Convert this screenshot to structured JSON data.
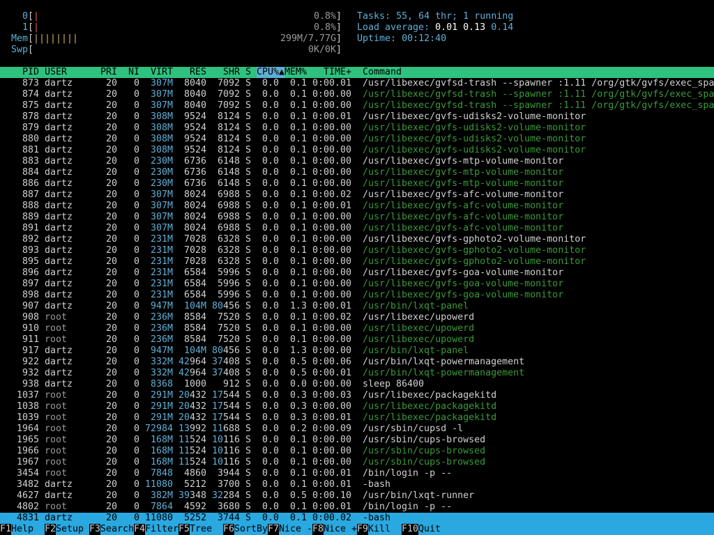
{
  "meters": {
    "cpu0": {
      "label": "0",
      "bar": "|",
      "value": "0.8%"
    },
    "cpu1": {
      "label": "1",
      "bar": "|",
      "value": "0.8%"
    },
    "mem": {
      "label": "Mem",
      "bar": "||||||||",
      "value": "299M/7.77G"
    },
    "swp": {
      "label": "Swp",
      "bar": "",
      "value": "0K/0K"
    }
  },
  "summary": {
    "tasks_label": "Tasks:",
    "tasks_count": "55",
    "threads": "64",
    "thr_label": "thr;",
    "running": "1",
    "running_label": "running",
    "load_label": "Load average:",
    "load1": "0.01",
    "load5": "0.13",
    "load15": "0.14",
    "uptime_label": "Uptime:",
    "uptime": "00:12:40"
  },
  "columns": {
    "pid": "PID",
    "user": "USER",
    "pri": "PRI",
    "ni": "NI",
    "virt": "VIRT",
    "res": "RES",
    "shr": "SHR",
    "s": "S",
    "cpu": "CPU%",
    "sort_arrow": "▲",
    "mem": "MEM%",
    "time": "TIME+",
    "command": "Command"
  },
  "processes": [
    {
      "pid": "873",
      "user": "dartz",
      "pri": "20",
      "ni": "0",
      "virt": "307M",
      "res": "8040",
      "shr": "7092",
      "s": "S",
      "cpu": "0.0",
      "mem": "0.1",
      "time": "0:00.01",
      "cmd": "/usr/libexec/gvfsd-trash --spawner :1.11 /org/gtk/gvfs/exec_spa",
      "thread": false
    },
    {
      "pid": "874",
      "user": "dartz",
      "pri": "20",
      "ni": "0",
      "virt": "307M",
      "res": "8040",
      "shr": "7092",
      "s": "S",
      "cpu": "0.0",
      "mem": "0.1",
      "time": "0:00.00",
      "cmd": "/usr/libexec/gvfsd-trash --spawner :1.11 /org/gtk/gvfs/exec_spa",
      "thread": true
    },
    {
      "pid": "875",
      "user": "dartz",
      "pri": "20",
      "ni": "0",
      "virt": "307M",
      "res": "8040",
      "shr": "7092",
      "s": "S",
      "cpu": "0.0",
      "mem": "0.1",
      "time": "0:00.00",
      "cmd": "/usr/libexec/gvfsd-trash --spawner :1.11 /org/gtk/gvfs/exec_spa",
      "thread": true
    },
    {
      "pid": "878",
      "user": "dartz",
      "pri": "20",
      "ni": "0",
      "virt": "308M",
      "res": "9524",
      "shr": "8124",
      "s": "S",
      "cpu": "0.0",
      "mem": "0.1",
      "time": "0:00.01",
      "cmd": "/usr/libexec/gvfs-udisks2-volume-monitor",
      "thread": false
    },
    {
      "pid": "879",
      "user": "dartz",
      "pri": "20",
      "ni": "0",
      "virt": "308M",
      "res": "9524",
      "shr": "8124",
      "s": "S",
      "cpu": "0.0",
      "mem": "0.1",
      "time": "0:00.00",
      "cmd": "/usr/libexec/gvfs-udisks2-volume-monitor",
      "thread": true
    },
    {
      "pid": "880",
      "user": "dartz",
      "pri": "20",
      "ni": "0",
      "virt": "308M",
      "res": "9524",
      "shr": "8124",
      "s": "S",
      "cpu": "0.0",
      "mem": "0.1",
      "time": "0:00.00",
      "cmd": "/usr/libexec/gvfs-udisks2-volume-monitor",
      "thread": true
    },
    {
      "pid": "881",
      "user": "dartz",
      "pri": "20",
      "ni": "0",
      "virt": "308M",
      "res": "9524",
      "shr": "8124",
      "s": "S",
      "cpu": "0.0",
      "mem": "0.1",
      "time": "0:00.00",
      "cmd": "/usr/libexec/gvfs-udisks2-volume-monitor",
      "thread": true
    },
    {
      "pid": "883",
      "user": "dartz",
      "pri": "20",
      "ni": "0",
      "virt": "230M",
      "res": "6736",
      "shr": "6148",
      "s": "S",
      "cpu": "0.0",
      "mem": "0.1",
      "time": "0:00.00",
      "cmd": "/usr/libexec/gvfs-mtp-volume-monitor",
      "thread": false
    },
    {
      "pid": "884",
      "user": "dartz",
      "pri": "20",
      "ni": "0",
      "virt": "230M",
      "res": "6736",
      "shr": "6148",
      "s": "S",
      "cpu": "0.0",
      "mem": "0.1",
      "time": "0:00.00",
      "cmd": "/usr/libexec/gvfs-mtp-volume-monitor",
      "thread": true
    },
    {
      "pid": "886",
      "user": "dartz",
      "pri": "20",
      "ni": "0",
      "virt": "230M",
      "res": "6736",
      "shr": "6148",
      "s": "S",
      "cpu": "0.0",
      "mem": "0.1",
      "time": "0:00.00",
      "cmd": "/usr/libexec/gvfs-mtp-volume-monitor",
      "thread": true
    },
    {
      "pid": "887",
      "user": "dartz",
      "pri": "20",
      "ni": "0",
      "virt": "307M",
      "res": "8024",
      "shr": "6988",
      "s": "S",
      "cpu": "0.0",
      "mem": "0.1",
      "time": "0:00.02",
      "cmd": "/usr/libexec/gvfs-afc-volume-monitor",
      "thread": false
    },
    {
      "pid": "888",
      "user": "dartz",
      "pri": "20",
      "ni": "0",
      "virt": "307M",
      "res": "8024",
      "shr": "6988",
      "s": "S",
      "cpu": "0.0",
      "mem": "0.1",
      "time": "0:00.01",
      "cmd": "/usr/libexec/gvfs-afc-volume-monitor",
      "thread": true
    },
    {
      "pid": "889",
      "user": "dartz",
      "pri": "20",
      "ni": "0",
      "virt": "307M",
      "res": "8024",
      "shr": "6988",
      "s": "S",
      "cpu": "0.0",
      "mem": "0.1",
      "time": "0:00.00",
      "cmd": "/usr/libexec/gvfs-afc-volume-monitor",
      "thread": true
    },
    {
      "pid": "891",
      "user": "dartz",
      "pri": "20",
      "ni": "0",
      "virt": "307M",
      "res": "8024",
      "shr": "6988",
      "s": "S",
      "cpu": "0.0",
      "mem": "0.1",
      "time": "0:00.00",
      "cmd": "/usr/libexec/gvfs-afc-volume-monitor",
      "thread": true
    },
    {
      "pid": "892",
      "user": "dartz",
      "pri": "20",
      "ni": "0",
      "virt": "231M",
      "res": "7028",
      "shr": "6328",
      "s": "S",
      "cpu": "0.0",
      "mem": "0.1",
      "time": "0:00.00",
      "cmd": "/usr/libexec/gvfs-gphoto2-volume-monitor",
      "thread": false
    },
    {
      "pid": "893",
      "user": "dartz",
      "pri": "20",
      "ni": "0",
      "virt": "231M",
      "res": "7028",
      "shr": "6328",
      "s": "S",
      "cpu": "0.0",
      "mem": "0.1",
      "time": "0:00.00",
      "cmd": "/usr/libexec/gvfs-gphoto2-volume-monitor",
      "thread": true
    },
    {
      "pid": "895",
      "user": "dartz",
      "pri": "20",
      "ni": "0",
      "virt": "231M",
      "res": "7028",
      "shr": "6328",
      "s": "S",
      "cpu": "0.0",
      "mem": "0.1",
      "time": "0:00.00",
      "cmd": "/usr/libexec/gvfs-gphoto2-volume-monitor",
      "thread": true
    },
    {
      "pid": "896",
      "user": "dartz",
      "pri": "20",
      "ni": "0",
      "virt": "231M",
      "res": "6584",
      "shr": "5996",
      "s": "S",
      "cpu": "0.0",
      "mem": "0.1",
      "time": "0:00.00",
      "cmd": "/usr/libexec/gvfs-goa-volume-monitor",
      "thread": false
    },
    {
      "pid": "897",
      "user": "dartz",
      "pri": "20",
      "ni": "0",
      "virt": "231M",
      "res": "6584",
      "shr": "5996",
      "s": "S",
      "cpu": "0.0",
      "mem": "0.1",
      "time": "0:00.00",
      "cmd": "/usr/libexec/gvfs-goa-volume-monitor",
      "thread": true
    },
    {
      "pid": "898",
      "user": "dartz",
      "pri": "20",
      "ni": "0",
      "virt": "231M",
      "res": "6584",
      "shr": "5996",
      "s": "S",
      "cpu": "0.0",
      "mem": "0.1",
      "time": "0:00.00",
      "cmd": "/usr/libexec/gvfs-goa-volume-monitor",
      "thread": true
    },
    {
      "pid": "907",
      "user": "dartz",
      "pri": "20",
      "ni": "0",
      "virt": "947M",
      "res": "104M",
      "shr": "80456",
      "s": "S",
      "cpu": "0.0",
      "mem": "1.3",
      "time": "0:00.01",
      "cmd": "/usr/bin/lxqt-panel",
      "thread": true
    },
    {
      "pid": "908",
      "user": "root",
      "pri": "20",
      "ni": "0",
      "virt": "236M",
      "res": "8584",
      "shr": "7520",
      "s": "S",
      "cpu": "0.0",
      "mem": "0.1",
      "time": "0:00.02",
      "cmd": "/usr/libexec/upowerd",
      "thread": false
    },
    {
      "pid": "910",
      "user": "root",
      "pri": "20",
      "ni": "0",
      "virt": "236M",
      "res": "8584",
      "shr": "7520",
      "s": "S",
      "cpu": "0.0",
      "mem": "0.1",
      "time": "0:00.00",
      "cmd": "/usr/libexec/upowerd",
      "thread": true
    },
    {
      "pid": "911",
      "user": "root",
      "pri": "20",
      "ni": "0",
      "virt": "236M",
      "res": "8584",
      "shr": "7520",
      "s": "S",
      "cpu": "0.0",
      "mem": "0.1",
      "time": "0:00.00",
      "cmd": "/usr/libexec/upowerd",
      "thread": true
    },
    {
      "pid": "917",
      "user": "dartz",
      "pri": "20",
      "ni": "0",
      "virt": "947M",
      "res": "104M",
      "shr": "80456",
      "s": "S",
      "cpu": "0.0",
      "mem": "1.3",
      "time": "0:00.00",
      "cmd": "/usr/bin/lxqt-panel",
      "thread": true
    },
    {
      "pid": "922",
      "user": "dartz",
      "pri": "20",
      "ni": "0",
      "virt": "332M",
      "res": "42964",
      "shr": "37408",
      "s": "S",
      "cpu": "0.0",
      "mem": "0.5",
      "time": "0:00.06",
      "cmd": "/usr/bin/lxqt-powermanagement",
      "thread": false
    },
    {
      "pid": "932",
      "user": "dartz",
      "pri": "20",
      "ni": "0",
      "virt": "332M",
      "res": "42964",
      "shr": "37408",
      "s": "S",
      "cpu": "0.0",
      "mem": "0.5",
      "time": "0:00.01",
      "cmd": "/usr/bin/lxqt-powermanagement",
      "thread": true
    },
    {
      "pid": "938",
      "user": "dartz",
      "pri": "20",
      "ni": "0",
      "virt": "8368",
      "res": "1000",
      "shr": "912",
      "s": "S",
      "cpu": "0.0",
      "mem": "0.0",
      "time": "0:00.00",
      "cmd": "sleep 86400",
      "thread": false
    },
    {
      "pid": "1037",
      "user": "root",
      "pri": "20",
      "ni": "0",
      "virt": "291M",
      "res": "20432",
      "shr": "17544",
      "s": "S",
      "cpu": "0.0",
      "mem": "0.3",
      "time": "0:00.03",
      "cmd": "/usr/libexec/packagekitd",
      "thread": false
    },
    {
      "pid": "1038",
      "user": "root",
      "pri": "20",
      "ni": "0",
      "virt": "291M",
      "res": "20432",
      "shr": "17544",
      "s": "S",
      "cpu": "0.0",
      "mem": "0.3",
      "time": "0:00.00",
      "cmd": "/usr/libexec/packagekitd",
      "thread": true
    },
    {
      "pid": "1039",
      "user": "root",
      "pri": "20",
      "ni": "0",
      "virt": "291M",
      "res": "20432",
      "shr": "17544",
      "s": "S",
      "cpu": "0.0",
      "mem": "0.3",
      "time": "0:00.01",
      "cmd": "/usr/libexec/packagekitd",
      "thread": true
    },
    {
      "pid": "1964",
      "user": "root",
      "pri": "20",
      "ni": "0",
      "virt": "72984",
      "res": "13992",
      "shr": "11688",
      "s": "S",
      "cpu": "0.0",
      "mem": "0.2",
      "time": "0:00.09",
      "cmd": "/usr/sbin/cupsd -l",
      "thread": false
    },
    {
      "pid": "1965",
      "user": "root",
      "pri": "20",
      "ni": "0",
      "virt": "168M",
      "res": "11524",
      "shr": "10116",
      "s": "S",
      "cpu": "0.0",
      "mem": "0.1",
      "time": "0:00.00",
      "cmd": "/usr/sbin/cups-browsed",
      "thread": false
    },
    {
      "pid": "1966",
      "user": "root",
      "pri": "20",
      "ni": "0",
      "virt": "168M",
      "res": "11524",
      "shr": "10116",
      "s": "S",
      "cpu": "0.0",
      "mem": "0.1",
      "time": "0:00.00",
      "cmd": "/usr/sbin/cups-browsed",
      "thread": true
    },
    {
      "pid": "1967",
      "user": "root",
      "pri": "20",
      "ni": "0",
      "virt": "168M",
      "res": "11524",
      "shr": "10116",
      "s": "S",
      "cpu": "0.0",
      "mem": "0.1",
      "time": "0:00.00",
      "cmd": "/usr/sbin/cups-browsed",
      "thread": true
    },
    {
      "pid": "3454",
      "user": "root",
      "pri": "20",
      "ni": "0",
      "virt": "7848",
      "res": "4860",
      "shr": "3944",
      "s": "S",
      "cpu": "0.0",
      "mem": "0.1",
      "time": "0:00.01",
      "cmd": "/bin/login -p --",
      "thread": false
    },
    {
      "pid": "3482",
      "user": "dartz",
      "pri": "20",
      "ni": "0",
      "virt": "11080",
      "res": "5212",
      "shr": "3700",
      "s": "S",
      "cpu": "0.0",
      "mem": "0.1",
      "time": "0:00.01",
      "cmd": "-bash",
      "thread": false
    },
    {
      "pid": "4627",
      "user": "dartz",
      "pri": "20",
      "ni": "0",
      "virt": "382M",
      "res": "39348",
      "shr": "32284",
      "s": "S",
      "cpu": "0.0",
      "mem": "0.5",
      "time": "0:00.10",
      "cmd": "/usr/bin/lxqt-runner",
      "thread": false
    },
    {
      "pid": "4802",
      "user": "root",
      "pri": "20",
      "ni": "0",
      "virt": "7864",
      "res": "4592",
      "shr": "3680",
      "s": "S",
      "cpu": "0.0",
      "mem": "0.1",
      "time": "0:00.01",
      "cmd": "/bin/login -p --",
      "thread": false
    },
    {
      "pid": "4831",
      "user": "dartz",
      "pri": "20",
      "ni": "0",
      "virt": "11080",
      "res": "5252",
      "shr": "3744",
      "s": "S",
      "cpu": "0.0",
      "mem": "0.1",
      "time": "0:00.02",
      "cmd": "-bash",
      "thread": false,
      "selected": true
    }
  ],
  "function_keys": [
    {
      "key": "F1",
      "label": "Help"
    },
    {
      "key": "F2",
      "label": "Setup"
    },
    {
      "key": "F3",
      "label": "Search"
    },
    {
      "key": "F4",
      "label": "Filter"
    },
    {
      "key": "F5",
      "label": "Tree"
    },
    {
      "key": "F6",
      "label": "SortBy"
    },
    {
      "key": "F7",
      "label": "Nice -"
    },
    {
      "key": "F8",
      "label": "Nice +"
    },
    {
      "key": "F9",
      "label": "Kill"
    },
    {
      "key": "F10",
      "label": "Quit"
    }
  ],
  "colors": {
    "header_bar": "#2ec27e",
    "selected_row": "#2aa8e0",
    "accent_cyan": "#5fafd7",
    "thread_green": "#3a9a3a"
  }
}
